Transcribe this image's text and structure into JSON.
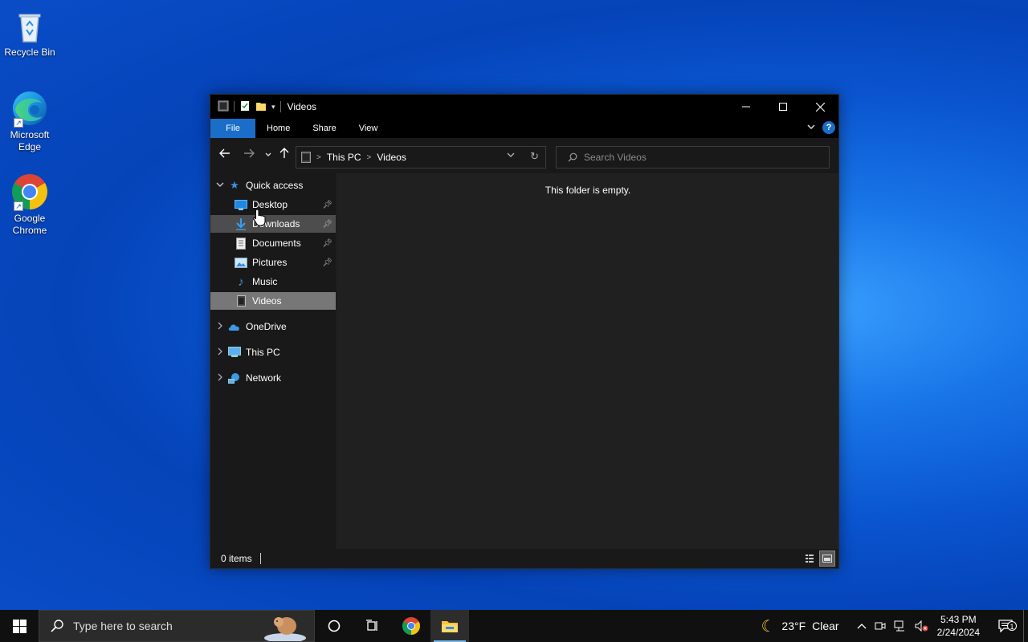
{
  "desktop": {
    "icons": [
      {
        "label": "Recycle Bin"
      },
      {
        "label": "Microsoft Edge"
      },
      {
        "label": "Google Chrome"
      }
    ]
  },
  "window": {
    "title": "Videos",
    "ribbon_tabs": [
      "File",
      "Home",
      "Share",
      "View"
    ],
    "address": {
      "crumbs": [
        "This PC",
        "Videos"
      ]
    },
    "search": {
      "placeholder": "Search Videos"
    },
    "navpane": {
      "quick_access": "Quick access",
      "quick_items": [
        {
          "label": "Desktop",
          "icon": "desktop-icon",
          "pinned": true
        },
        {
          "label": "Downloads",
          "icon": "downloads-icon",
          "pinned": true
        },
        {
          "label": "Documents",
          "icon": "documents-icon",
          "pinned": true
        },
        {
          "label": "Pictures",
          "icon": "pictures-icon",
          "pinned": true
        },
        {
          "label": "Music",
          "icon": "music-icon",
          "pinned": false
        },
        {
          "label": "Videos",
          "icon": "videos-icon",
          "pinned": false
        }
      ],
      "roots": [
        {
          "label": "OneDrive",
          "icon": "onedrive-icon"
        },
        {
          "label": "This PC",
          "icon": "this-pc-icon"
        },
        {
          "label": "Network",
          "icon": "network-icon"
        }
      ]
    },
    "content": {
      "empty_message": "This folder is empty."
    },
    "status": {
      "item_count": "0 items"
    }
  },
  "taskbar": {
    "search_placeholder": "Type here to search",
    "weather": {
      "temp": "23°F",
      "condition": "Clear"
    },
    "clock": {
      "time": "5:43 PM",
      "date": "2/24/2024"
    },
    "notification_count": "1"
  },
  "colors": {
    "accent": "#1a6dc9",
    "selected": "#777777",
    "hover": "#4d4d4d"
  }
}
